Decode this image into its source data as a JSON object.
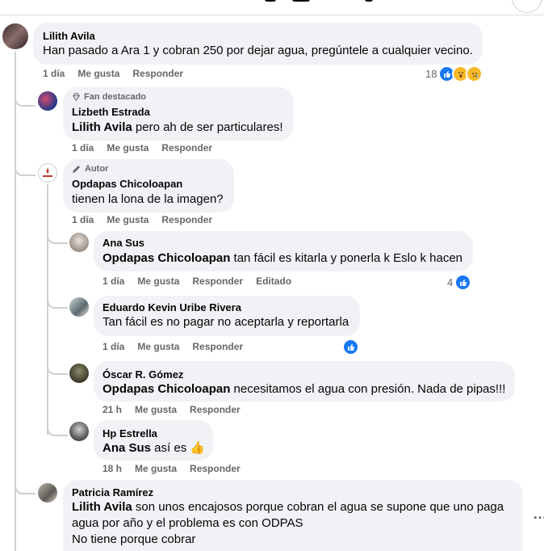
{
  "colors": {
    "accent": "#1877f2",
    "bubble": "#f0f2f5",
    "meta": "#65676b",
    "thread": "#ced0d4"
  },
  "comments": [
    {
      "author": "Lilith Avila",
      "text": "Han pasado a Ara 1 y cobran 250 por dejar agua, pregúntele a cualquier vecino.",
      "time": "1 día",
      "like": "Me gusta",
      "reply": "Responder",
      "reactions_count": "18",
      "reactions": [
        "like-icon",
        "wow-icon",
        "sad-icon"
      ]
    },
    {
      "badge": "Fan destacado",
      "badge_icon": "diamond-icon",
      "author": "Lizbeth Estrada",
      "mention": "Lilith Avila",
      "text": " pero ah de ser particulares!",
      "time": "1 día",
      "like": "Me gusta",
      "reply": "Responder"
    },
    {
      "badge": "Autor",
      "badge_icon": "pencil-icon",
      "author": "Opdapas Chicoloapan",
      "text": "tienen la lona de la imagen?",
      "time": "1 día",
      "like": "Me gusta",
      "reply": "Responder"
    },
    {
      "author": "Ana Sus",
      "mention": "Opdapas Chicoloapan",
      "text": " tan fácil es kitarla y ponerla k Eslo k hacen",
      "time": "1 día",
      "like": "Me gusta",
      "reply": "Responder",
      "edited": "Editado",
      "reactions_count": "4",
      "reactions": [
        "like-icon"
      ]
    },
    {
      "author": "Eduardo Kevin Uribe Rivera",
      "text": "Tan fácil es no pagar no aceptarla y reportarla",
      "time": "1 día",
      "like": "Me gusta",
      "reply": "Responder",
      "reactions": [
        "like-icon"
      ]
    },
    {
      "author": "Óscar R. Gómez",
      "mention": "Opdapas Chicoloapan",
      "text": " necesitamos el agua con presión. Nada de pipas!!!",
      "time": "21 h",
      "like": "Me gusta",
      "reply": "Responder"
    },
    {
      "author": "Hp Estrella",
      "mention": "Ana Sus",
      "text": " así es ",
      "emoji": "👍",
      "time": "18 h",
      "like": "Me gusta",
      "reply": "Responder"
    },
    {
      "author": "Patricia Ramírez",
      "mention": "Lilith Avila",
      "text_line1": " son unos encajosos porque cobran el agua se supone que uno paga",
      "text_line2": "agua por año y el problema es con ODPAS",
      "text_line3": "No tiene porque cobrar"
    }
  ],
  "more_icon": "…"
}
